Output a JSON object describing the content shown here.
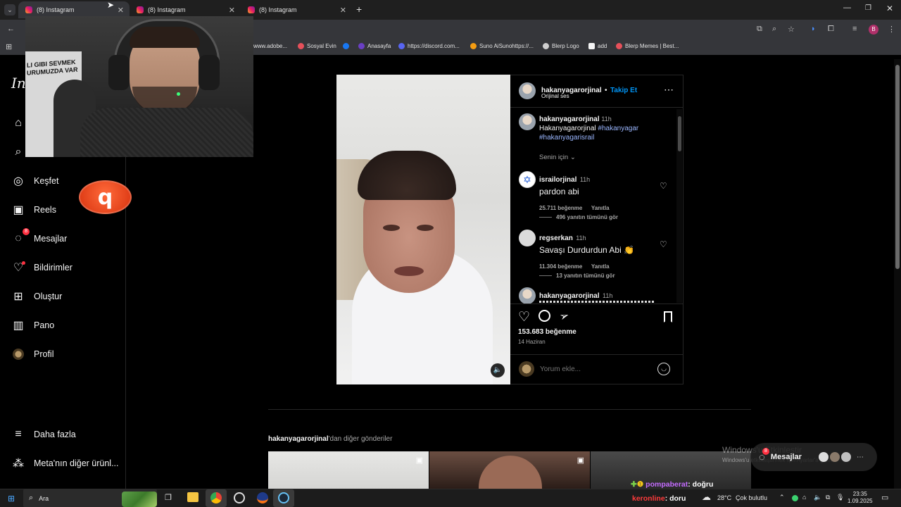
{
  "browser": {
    "tabs": [
      {
        "label": "(8) Instagram",
        "active": true
      },
      {
        "label": "(8) Instagram",
        "active": false
      },
      {
        "label": "(8) Instagram",
        "active": false
      }
    ],
    "bookmarks": [
      {
        "label": "www.adobe...",
        "color": "#e03a2e"
      },
      {
        "label": "Sosyal Evin",
        "color": "#e6505a"
      },
      {
        "label": "Anasayfa",
        "color": "#1877f2"
      },
      {
        "label": "Anasayfa",
        "color": "#6a3fc4"
      },
      {
        "label": "https://discord.com...",
        "color": "#5865f2"
      },
      {
        "label": "Suno AiSunohttps://...",
        "color": "#f39c12"
      },
      {
        "label": "Blerp Logo",
        "color": "#cfcfcf"
      },
      {
        "label": "add",
        "color": "#f5f5f5"
      },
      {
        "label": "Blerp Memes | Best...",
        "color": "#e6505a"
      }
    ],
    "profile_initial": "B"
  },
  "sidebar": {
    "logo_partial": "In",
    "items": [
      {
        "label": "Keşfet",
        "icon": "compass-icon"
      },
      {
        "label": "Reels",
        "icon": "reels-icon"
      },
      {
        "label": "Mesajlar",
        "icon": "messenger-icon",
        "badge": "8"
      },
      {
        "label": "Bildirimler",
        "icon": "heart-icon"
      },
      {
        "label": "Oluştur",
        "icon": "create-icon"
      },
      {
        "label": "Pano",
        "icon": "dashboard-icon"
      },
      {
        "label": "Profil",
        "icon": "avatar-icon"
      }
    ],
    "more_label": "Daha fazla",
    "meta_label": "Meta'nın diğer ürünl..."
  },
  "webcam": {
    "poster_text_1": "LI GIBI SEVMEK",
    "poster_text_2": "URUMUZDA VAR"
  },
  "overlay_logo_text": "q",
  "post": {
    "author": "hakanyagarorjinal",
    "follow_label": "Takip Et",
    "separator": "•",
    "audio": "Orijinal ses",
    "caption_author": "hakanyagarorjinal",
    "caption_time": "11h",
    "caption_text": "Hakanyagarorjinal",
    "caption_tag1": "#hakanyagar",
    "caption_tag2": "#hakanyagarisrail",
    "filter_label": "Senin için",
    "comments": [
      {
        "user": "israilorjinal",
        "time": "11h",
        "text": "pardon abi",
        "likes": "25.711 beğenme",
        "reply": "Yanıtla",
        "view_replies": "496 yanıtın tümünü gör"
      },
      {
        "user": "regserkan",
        "time": "11h",
        "text": "Savaşı Durdurdun Abi 👏",
        "likes": "11.304 beğenme",
        "reply": "Yanıtla",
        "view_replies": "13 yanıtın tümünü gör"
      },
      {
        "user": "hakanyagarorjinal",
        "time": "11h",
        "text": ""
      }
    ],
    "likes_count": "153.683 beğenme",
    "date": "14 Haziran",
    "comment_placeholder": "Yorum ekle...",
    "more_posts_user": "hakanyagarorjinal",
    "more_posts_suffix": "'dan diğer gönderiler"
  },
  "windows_watermark": {
    "line1": "Windows'u Etkinleştir",
    "line2": "Windows'u etkinleştirmek için Ayarlar'a gidin."
  },
  "messages_pill": {
    "label": "Mesajlar",
    "badge": "8"
  },
  "chat_overlay": {
    "line1_user": "pompaberat",
    "line1_text": ": doğru",
    "line2_user": "keronline",
    "line2_text": ": doru"
  },
  "taskbar": {
    "search_placeholder": "Ara",
    "weather_temp": "28°C",
    "weather_text": "Çok bulutlu",
    "time": "23:35",
    "date": "1.09.2025"
  },
  "colors": {
    "accent_blue": "#0095f6",
    "tag_blue": "#9bb7ff",
    "badge_red": "#ff3040"
  }
}
